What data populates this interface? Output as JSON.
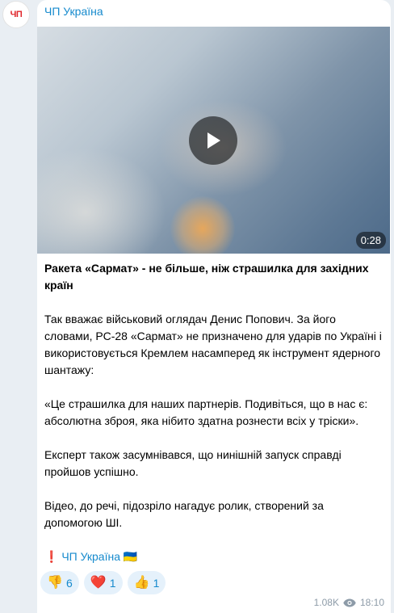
{
  "channel": {
    "avatar_text": "ЧП",
    "name": "ЧП Україна"
  },
  "video": {
    "duration": "0:28"
  },
  "post": {
    "title": "Ракета «Сармат» - не більше, ніж страшилка для західних країн",
    "paragraphs": [
      "Так вважає військовий оглядач Денис Попович. За його словами, РС-28 «Сармат» не призначено для ударів по Україні і використовується Кремлем насамперед як інструмент ядерного шантажу:",
      "«Це страшилка для наших партнерів. Подивіться, що в нас є: абсолютна зброя, яка нібито здатна рознести всіх у тріски».",
      "Експерт також засумнівався, що нинішній запуск справді пройшов успішно.",
      "Відео, до речі, підозріло нагадує ролик, створений за допомогою ШІ."
    ],
    "signature_mark": "❗",
    "signature": "ЧП Україна",
    "signature_flag": "🇺🇦"
  },
  "reactions": [
    {
      "icon": "thumbs-down",
      "emoji": "👎",
      "count": "6"
    },
    {
      "icon": "red-heart",
      "emoji": "❤️",
      "count": "1"
    },
    {
      "icon": "thumbs-up",
      "emoji": "👍",
      "count": "1"
    }
  ],
  "meta": {
    "views": "1.08K",
    "time": "18:10"
  },
  "colors": {
    "accent": "#168acd",
    "reaction_bg": "#e5f1fb",
    "chat_bg": "#e9eef3"
  }
}
